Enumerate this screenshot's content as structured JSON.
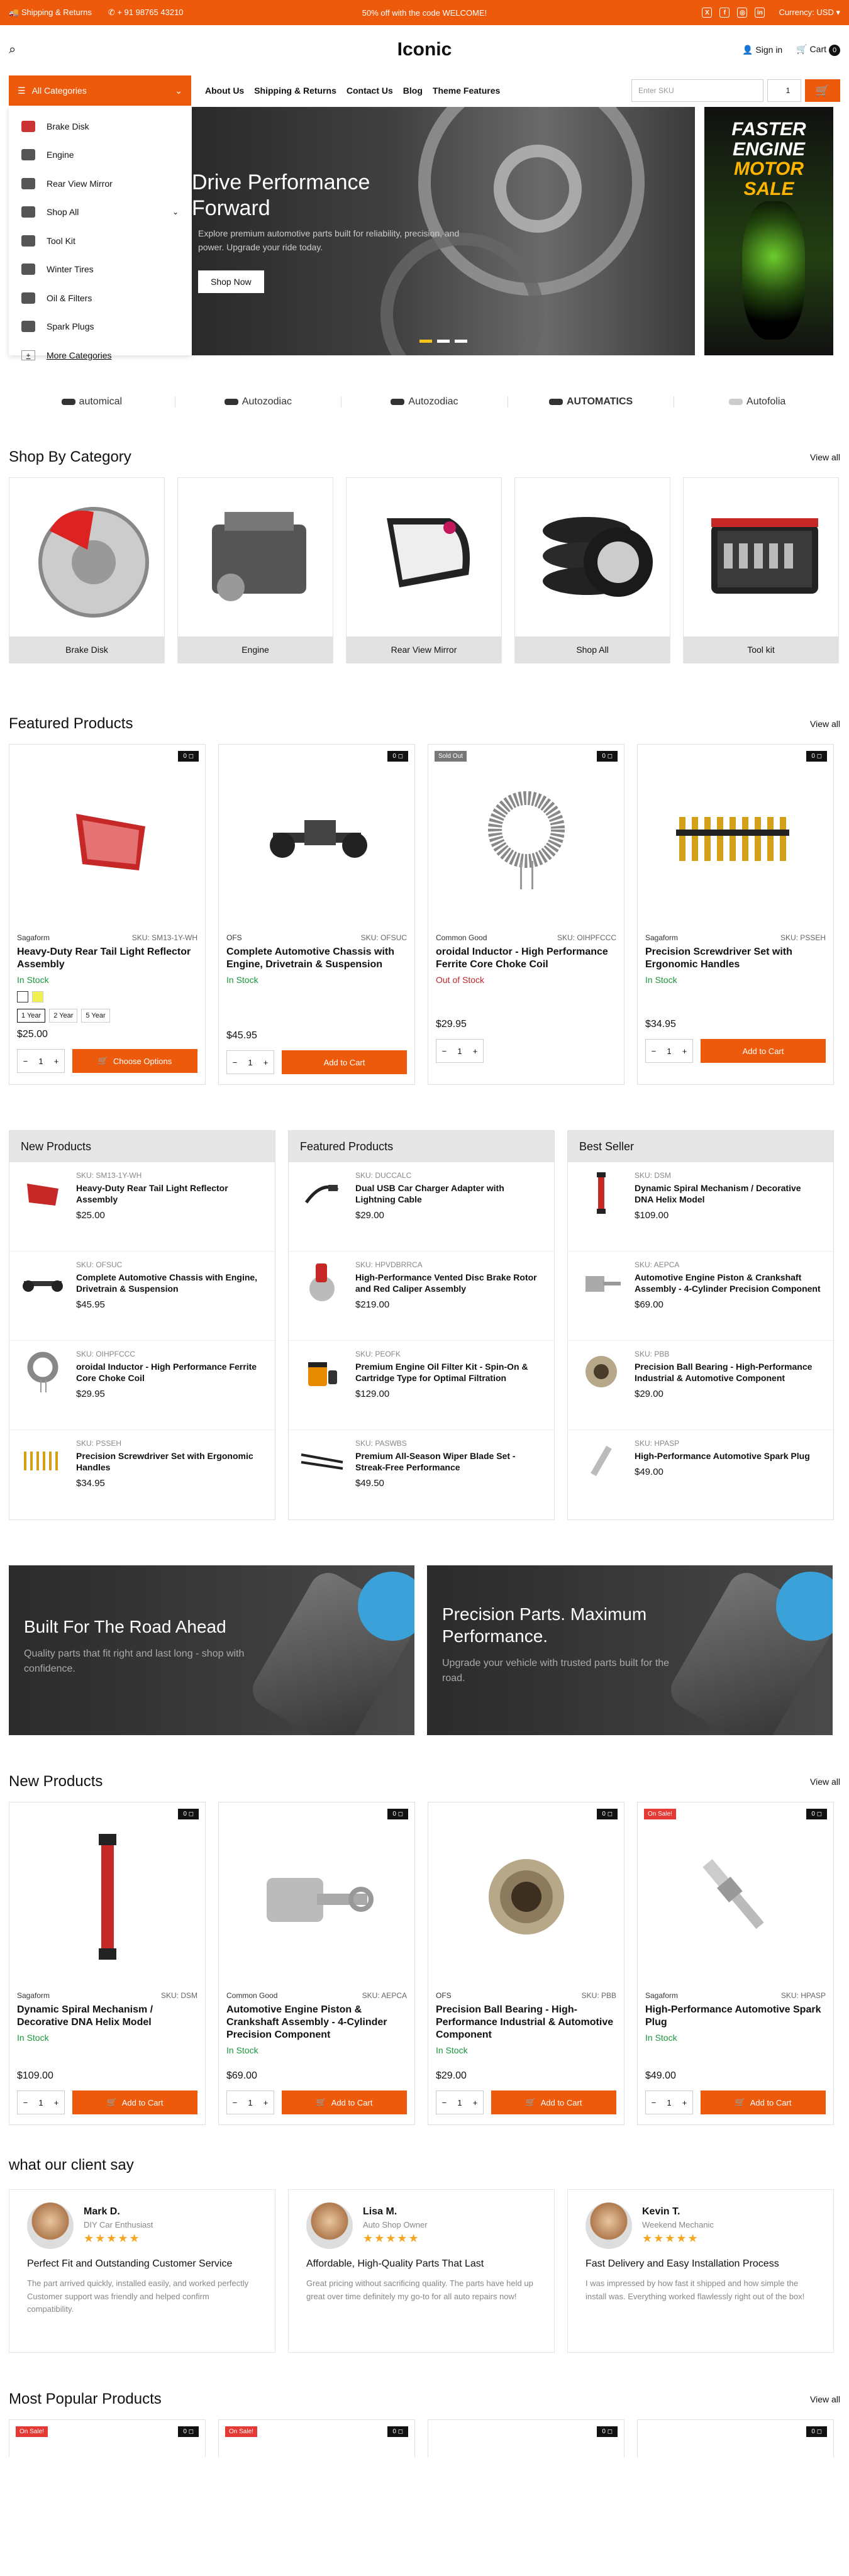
{
  "topbar": {
    "shipping": "Shipping & Returns",
    "phone": "+ 91 98765 43210",
    "promo": "50% off with the code WELCOME!",
    "currency": "Currency: USD"
  },
  "header": {
    "logo": "Iconic",
    "signin": "Sign in",
    "cart": "Cart",
    "cart_count": "0"
  },
  "nav": {
    "all_categories": "All Categories",
    "links": [
      "About Us",
      "Shipping & Returns",
      "Contact Us",
      "Blog",
      "Theme Features"
    ],
    "sku_placeholder": "Enter SKU",
    "sku_qty": "1"
  },
  "sidebar": {
    "items": [
      "Brake Disk",
      "Engine",
      "Rear View Mirror",
      "Shop All",
      "Tool Kit",
      "Winter Tires",
      "Oil & Filters",
      "Spark Plugs",
      "More Categories"
    ]
  },
  "hero": {
    "title": "Drive Performance Forward",
    "text": "Explore premium automotive parts built for reliability, precision, and power. Upgrade your ride today.",
    "button": "Shop Now",
    "promo1": "FASTER ENGINE",
    "promo2": "MOTOR SALE"
  },
  "brands": [
    "automical",
    "Autozodiac",
    "Autozodiac",
    "AUTOMATICS",
    "Autofolia"
  ],
  "shop_by_category": {
    "title": "Shop By Category",
    "view_all": "View all",
    "items": [
      "Brake Disk",
      "Engine",
      "Rear View Mirror",
      "Shop All",
      "Tool kit"
    ]
  },
  "featured": {
    "title": "Featured Products",
    "view_all": "View all",
    "products": [
      {
        "brand": "Sagaform",
        "sku": "SKU: SM13-1Y-WH",
        "name": "Heavy-Duty Rear Tail Light Reflector Assembly",
        "stock": "In Stock",
        "price": "$25.00",
        "button": "Choose Options",
        "qty": "1",
        "badge": "0 ◻",
        "variants": [
          "1 Year",
          "2 Year",
          "5 Year"
        ]
      },
      {
        "brand": "OFS",
        "sku": "SKU: OFSUC",
        "name": "Complete Automotive Chassis with Engine, Drivetrain & Suspension",
        "stock": "In Stock",
        "price": "$45.95",
        "button": "Add to Cart",
        "qty": "1",
        "badge": "0 ◻"
      },
      {
        "brand": "Common Good",
        "sku": "SKU: OIHPFCCC",
        "name": "oroidal Inductor - High Performance Ferrite Core Choke Coil",
        "stock": "Out of Stock",
        "price": "$29.95",
        "qty": "1",
        "badge": "0 ◻",
        "sold": "Sold Out"
      },
      {
        "brand": "Sagaform",
        "sku": "SKU: PSSEH",
        "name": "Precision Screwdriver Set with Ergonomic Handles",
        "stock": "In Stock",
        "price": "$34.95",
        "button": "Add to Cart",
        "qty": "1",
        "badge": "0 ◻"
      }
    ]
  },
  "lists": [
    {
      "title": "New Products",
      "items": [
        {
          "sku": "SKU: SM13-1Y-WH",
          "name": "Heavy-Duty Rear Tail Light Reflector Assembly",
          "price": "$25.00"
        },
        {
          "sku": "SKU: OFSUC",
          "name": "Complete Automotive Chassis with Engine, Drivetrain & Suspension",
          "price": "$45.95"
        },
        {
          "sku": "SKU: OIHPFCCC",
          "name": "oroidal Inductor - High Performance Ferrite Core Choke Coil",
          "price": "$29.95"
        },
        {
          "sku": "SKU: PSSEH",
          "name": "Precision Screwdriver Set with Ergonomic Handles",
          "price": "$34.95"
        }
      ]
    },
    {
      "title": "Featured Products",
      "items": [
        {
          "sku": "SKU: DUCCALC",
          "name": "Dual USB Car Charger Adapter with Lightning Cable",
          "price": "$29.00"
        },
        {
          "sku": "SKU: HPVDBRRCA",
          "name": "High-Performance Vented Disc Brake Rotor and Red Caliper Assembly",
          "price": "$219.00"
        },
        {
          "sku": "SKU: PEOFK",
          "name": "Premium Engine Oil Filter Kit - Spin-On & Cartridge Type for Optimal Filtration",
          "price": "$129.00"
        },
        {
          "sku": "SKU: PASWBS",
          "name": "Premium All-Season Wiper Blade Set - Streak-Free Performance",
          "price": "$49.50"
        }
      ]
    },
    {
      "title": "Best Seller",
      "items": [
        {
          "sku": "SKU: DSM",
          "name": "Dynamic Spiral Mechanism / Decorative DNA Helix Model",
          "price": "$109.00"
        },
        {
          "sku": "SKU: AEPCA",
          "name": "Automotive Engine Piston & Crankshaft Assembly - 4-Cylinder Precision Component",
          "price": "$69.00"
        },
        {
          "sku": "SKU: PBB",
          "name": "Precision Ball Bearing - High-Performance Industrial & Automotive Component",
          "price": "$29.00"
        },
        {
          "sku": "SKU: HPASP",
          "name": "High-Performance Automotive Spark Plug",
          "price": "$49.00"
        }
      ]
    }
  ],
  "banners": [
    {
      "title": "Built For The Road Ahead",
      "text": "Quality parts that fit right and last long - shop with confidence."
    },
    {
      "title": "Precision Parts. Maximum Performance.",
      "text": "Upgrade your vehicle with trusted parts built for the road."
    }
  ],
  "new_products": {
    "title": "New Products",
    "view_all": "View all",
    "products": [
      {
        "brand": "Sagaform",
        "sku": "SKU: DSM",
        "name": "Dynamic Spiral Mechanism / Decorative DNA Helix Model",
        "stock": "In Stock",
        "price": "$109.00",
        "button": "Add to Cart",
        "qty": "1",
        "badge": "0 ◻"
      },
      {
        "brand": "Common Good",
        "sku": "SKU: AEPCA",
        "name": "Automotive Engine Piston & Crankshaft Assembly - 4-Cylinder Precision Component",
        "stock": "In Stock",
        "price": "$69.00",
        "button": "Add to Cart",
        "qty": "1",
        "badge": "0 ◻"
      },
      {
        "brand": "OFS",
        "sku": "SKU: PBB",
        "name": "Precision Ball Bearing - High-Performance Industrial & Automotive Component",
        "stock": "In Stock",
        "price": "$29.00",
        "button": "Add to Cart",
        "qty": "1",
        "badge": "0 ◻"
      },
      {
        "brand": "Sagaform",
        "sku": "SKU: HPASP",
        "name": "High-Performance Automotive Spark Plug",
        "stock": "In Stock",
        "price": "$49.00",
        "button": "Add to Cart",
        "qty": "1",
        "badge": "0 ◻",
        "sale": "On Sale!"
      }
    ]
  },
  "testimonials": {
    "title": "what our client say",
    "items": [
      {
        "name": "Mark D.",
        "role": "DIY Car Enthusiast",
        "stars": "★★★★★",
        "title": "Perfect Fit and Outstanding Customer Service",
        "text": "The part arrived quickly, installed easily, and worked perfectly Customer support was friendly and helped confirm compatibility."
      },
      {
        "name": "Lisa M.",
        "role": "Auto Shop Owner",
        "stars": "★★★★★",
        "title": "Affordable, High-Quality Parts That Last",
        "text": "Great pricing without sacrificing quality. The parts have held up great over time definitely my go-to for all auto repairs now!"
      },
      {
        "name": "Kevin T.",
        "role": "Weekend Mechanic",
        "stars": "★★★★★",
        "title": "Fast Delivery and Easy Installation Process",
        "text": "I was impressed by how fast it shipped and how simple the install was. Everything worked flawlessly right out of the box!"
      }
    ]
  },
  "popular": {
    "title": "Most Popular Products",
    "view_all": "View all",
    "badges": [
      "On Sale!",
      "On Sale!",
      "",
      ""
    ],
    "badge_q": "0 ◻"
  }
}
